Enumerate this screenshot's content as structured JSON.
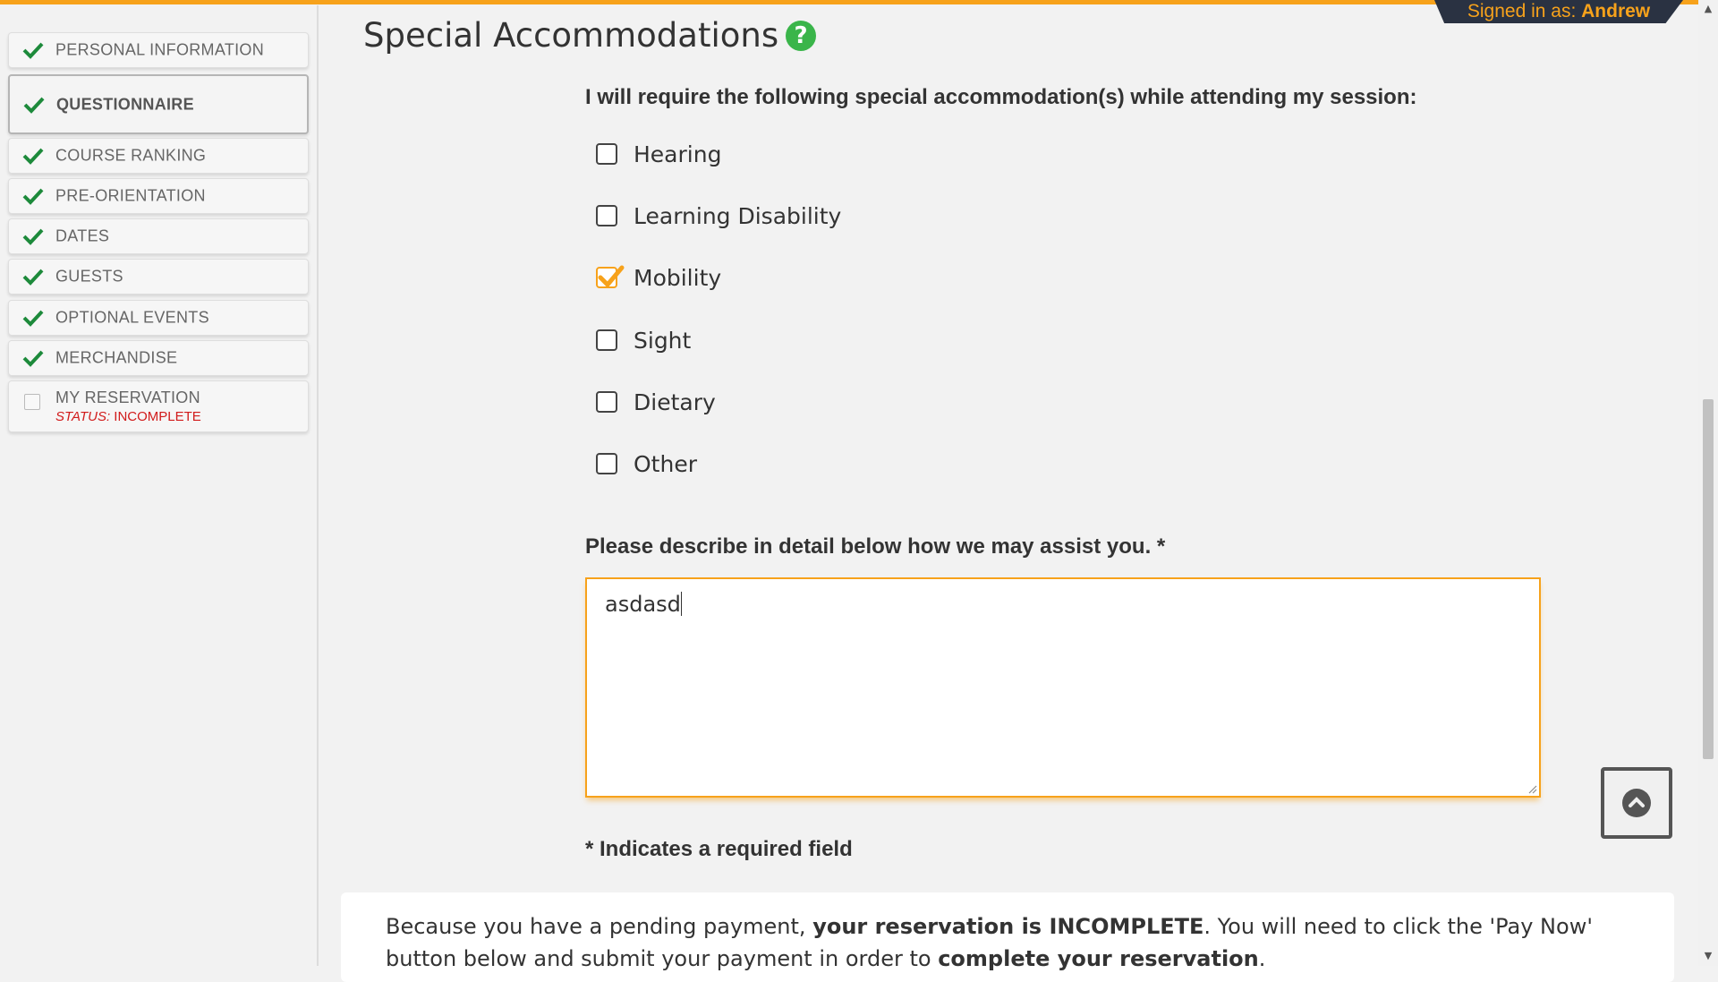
{
  "header": {
    "signed_in_prefix": "Signed in as:",
    "user_name": "Andrew"
  },
  "sidebar": {
    "items": [
      {
        "label": "PERSONAL INFORMATION",
        "completed": true
      },
      {
        "label": "QUESTIONNAIRE",
        "completed": true,
        "active": true
      },
      {
        "label": "COURSE RANKING",
        "completed": true
      },
      {
        "label": "PRE-ORIENTATION",
        "completed": true
      },
      {
        "label": "DATES",
        "completed": true
      },
      {
        "label": "GUESTS",
        "completed": true
      },
      {
        "label": "OPTIONAL EVENTS",
        "completed": true
      },
      {
        "label": "MERCHANDISE",
        "completed": true
      },
      {
        "label": "MY RESERVATION",
        "completed": false,
        "status_label": "STATUS:",
        "status_value": "INCOMPLETE"
      }
    ]
  },
  "main": {
    "title": "Special Accommodations",
    "help_icon": "?",
    "question": "I will require the following special accommodation(s) while attending my session:",
    "options": [
      {
        "label": "Hearing",
        "checked": false
      },
      {
        "label": "Learning Disability",
        "checked": false
      },
      {
        "label": "Mobility",
        "checked": true
      },
      {
        "label": "Sight",
        "checked": false
      },
      {
        "label": "Dietary",
        "checked": false
      },
      {
        "label": "Other",
        "checked": false
      }
    ],
    "textarea_label": "Please describe in detail below how we may assist you. *",
    "textarea_value": "asdasd",
    "required_note": "* Indicates a required field",
    "notice": {
      "part1": "Because you have a pending payment, ",
      "bold1": "your reservation is INCOMPLETE",
      "part2": ". You will need to click the 'Pay Now' button below and submit your payment in order to ",
      "bold2": "complete your reservation",
      "part3": "."
    }
  },
  "colors": {
    "accent": "#f7a21b",
    "check_green": "#1d8a3b",
    "help_green": "#3ab54a",
    "status_red": "#d11b1b",
    "banner_dark": "#2a3242"
  },
  "icons": {
    "nav_check": "check-icon",
    "help": "help-icon",
    "scroll_top": "chevron-up-icon"
  }
}
